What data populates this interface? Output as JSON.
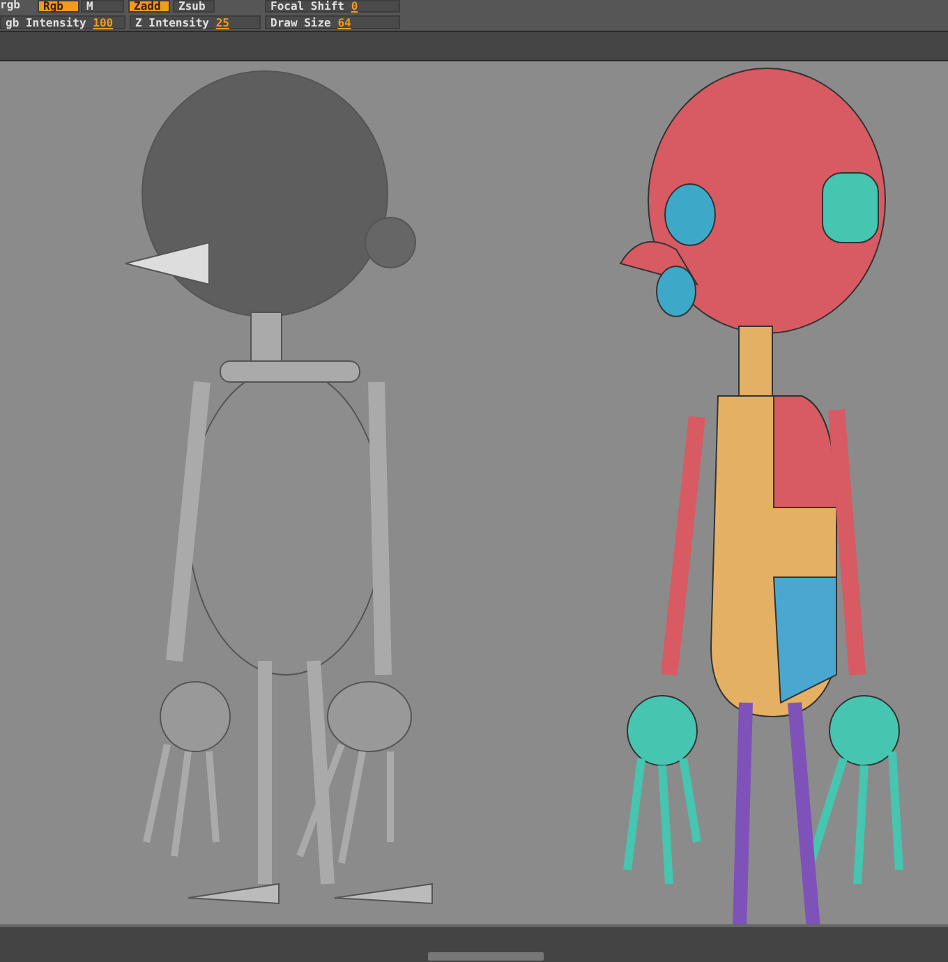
{
  "toolbar": {
    "row_1": [
      {
        "label": "rgb",
        "kind": "label"
      },
      {
        "label": "Rgb",
        "kind": "toggle",
        "selected": true
      },
      {
        "label": "M",
        "kind": "toggle",
        "selected": false
      },
      {
        "label": "Zadd",
        "kind": "toggle",
        "selected": true
      },
      {
        "label": "Zsub",
        "kind": "toggle",
        "selected": false
      },
      {
        "label": "Focal Shift",
        "value": "0",
        "kind": "slider"
      }
    ],
    "row_2": [
      {
        "label": "gb Intensity",
        "value": "100"
      },
      {
        "label": "Z Intensity",
        "value": "25"
      },
      {
        "label": "Draw Size",
        "value": "64"
      }
    ]
  },
  "viewport": {
    "models": [
      {
        "kind": "gray"
      },
      {
        "kind": "colored"
      }
    ]
  }
}
